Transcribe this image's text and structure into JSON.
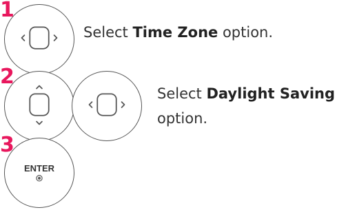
{
  "steps": [
    {
      "number": "1",
      "buttons": [
        "left-right-nav-icon"
      ],
      "text_before": "Select ",
      "text_bold": "Time Zone",
      "text_after": " option."
    },
    {
      "number": "2",
      "buttons": [
        "up-down-nav-icon",
        "left-right-nav-icon"
      ],
      "text_before": "Select ",
      "text_bold": "Daylight Saving",
      "text_after": "option."
    },
    {
      "number": "3",
      "buttons": [
        "enter-button-icon"
      ],
      "enter_label": "ENTER"
    }
  ],
  "colors": {
    "step_number": "#e8175d",
    "outline": "#555555",
    "text": "#333333"
  }
}
